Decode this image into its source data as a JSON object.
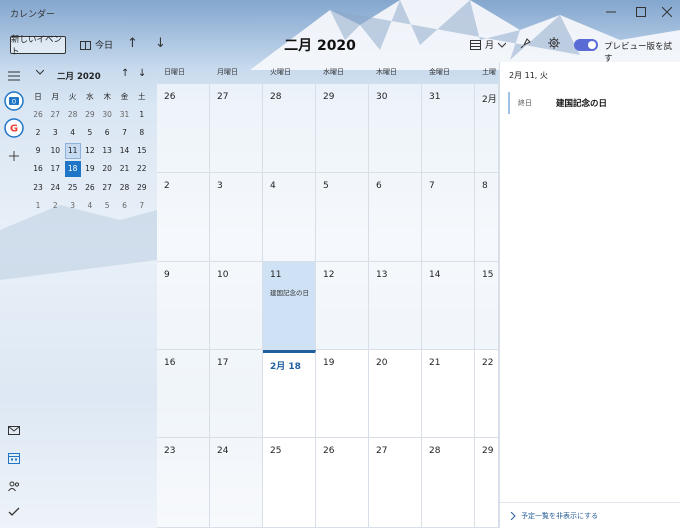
{
  "app": {
    "title": "カレンダー"
  },
  "toolbar": {
    "new_event": "新しいイベント",
    "today": "今日",
    "month_title": "二月 2020",
    "view": "月",
    "preview": "プレビュー版を試す"
  },
  "mini": {
    "title": "二月 2020",
    "dows": [
      "日",
      "月",
      "火",
      "水",
      "木",
      "金",
      "土"
    ],
    "weeks": [
      [
        "26",
        "27",
        "28",
        "29",
        "30",
        "31",
        "1"
      ],
      [
        "2",
        "3",
        "4",
        "5",
        "6",
        "7",
        "8"
      ],
      [
        "9",
        "10",
        "11",
        "12",
        "13",
        "14",
        "15"
      ],
      [
        "16",
        "17",
        "18",
        "19",
        "20",
        "21",
        "22"
      ],
      [
        "23",
        "24",
        "25",
        "26",
        "27",
        "28",
        "29"
      ],
      [
        "1",
        "2",
        "3",
        "4",
        "5",
        "6",
        "7"
      ]
    ],
    "selected_day": "11",
    "today_day": "18"
  },
  "grid": {
    "dows": [
      "日曜日",
      "月曜日",
      "火曜日",
      "水曜日",
      "木曜日",
      "金曜日",
      "土曜"
    ],
    "weeks": [
      [
        "26",
        "27",
        "28",
        "29",
        "30",
        "31",
        "2月"
      ],
      [
        "2",
        "3",
        "4",
        "5",
        "6",
        "7",
        "8"
      ],
      [
        "9",
        "10",
        "11",
        "12",
        "13",
        "14",
        "15"
      ],
      [
        "16",
        "17",
        "2月 18",
        "19",
        "20",
        "21",
        "22"
      ],
      [
        "23",
        "24",
        "25",
        "26",
        "27",
        "28",
        "29"
      ]
    ],
    "event_text": "建国記念の日"
  },
  "panel": {
    "date": "2月 11, 火",
    "agenda": {
      "time": "終日",
      "title": "建国記念の日"
    },
    "footer": "予定一覧を非表示にする"
  },
  "colors": {
    "accent": "#1f75c6",
    "toggle": "#5b6bd6",
    "selected": "#cfe2f5"
  }
}
